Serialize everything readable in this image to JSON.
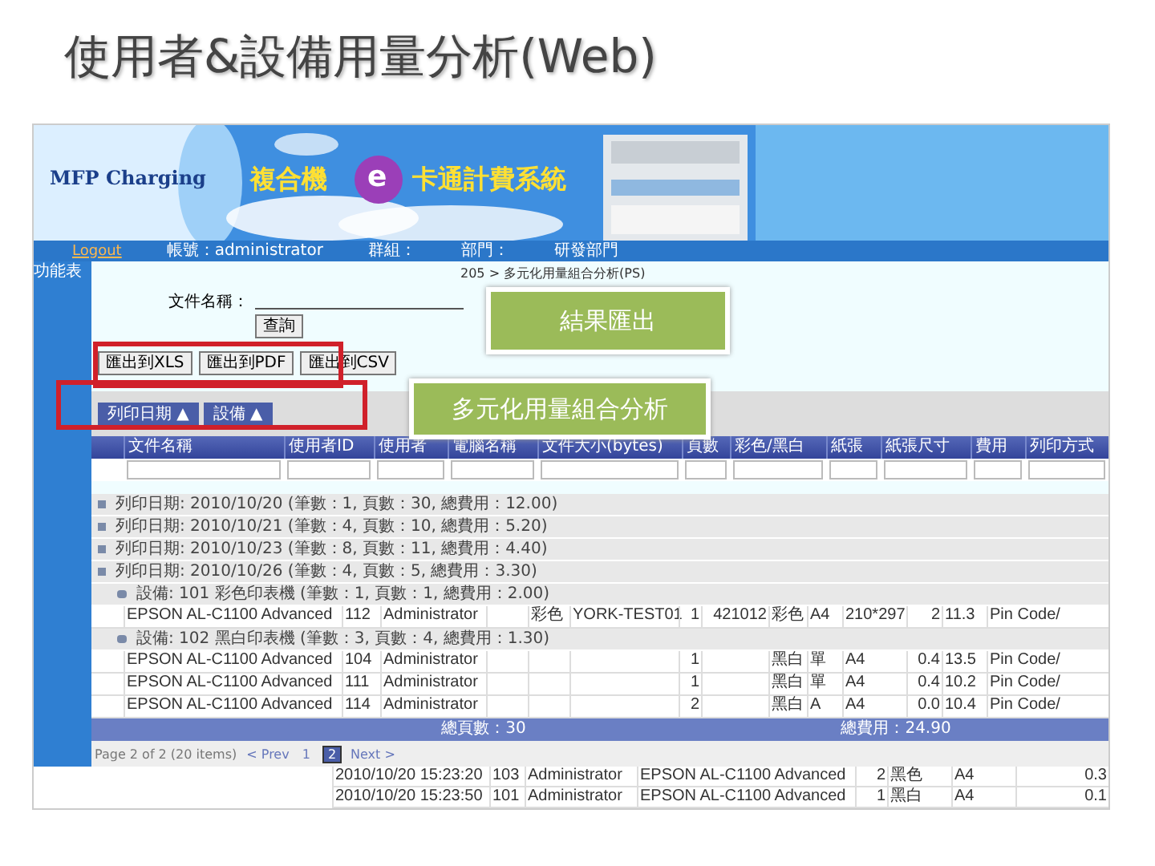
{
  "slide": {
    "title": "使用者&設備用量分析(Web)"
  },
  "banner": {
    "logo": "MFP Charging",
    "title_left": "複合機",
    "title_letter": "e",
    "title_right": "卡通計費系統"
  },
  "nav": {
    "logout": "Logout",
    "items": [
      "帳號：administrator",
      "群組：",
      "部門：",
      "研發部門"
    ]
  },
  "sidebar": {
    "items": [
      "功能表"
    ]
  },
  "breadcrumb": "205 > 多元化用量組合分析(PS)",
  "filter": {
    "label": "文件名稱：",
    "button": "查詢"
  },
  "export_buttons": [
    "匯出到XLS",
    "匯出到PDF",
    "匯出到CSV"
  ],
  "group_buttons": [
    {
      "label": "列印日期",
      "arrow": "▲"
    },
    {
      "label": "設備",
      "arrow": "▲"
    }
  ],
  "table": {
    "columns": [
      "文件名稱",
      "使用者ID",
      "使用者",
      "電腦名稱",
      "文件大小(bytes)",
      "頁數",
      "彩色/黑白",
      "紙張",
      "紙張尺寸",
      "費用",
      "列印方式"
    ],
    "groups": [
      {
        "label": "列印日期: 2010/10/20 (筆數：1, 頁數：30, 總費用：12.00)"
      },
      {
        "label": "列印日期: 2010/10/21 (筆數：4, 頁數：10, 總費用：5.20)"
      },
      {
        "label": "列印日期: 2010/10/23 (筆數：8, 頁數：11, 總費用：4.40)"
      },
      {
        "label": "列印日期: 2010/10/26 (筆數：4, 頁數：5, 總費用：3.30)",
        "children": [
          {
            "label": "設備: 101 彩色印表機 (筆數：1, 頁數：1, 總費用：2.00)",
            "rows": [
              [
                "EPSON AL-C1100 Advanced",
                "112",
                "Administrator",
                "",
                "彩色",
                "YORK-TEST01",
                "1",
                "421012",
                "彩色",
                "A4",
                "210*297",
                "2",
                "11.3",
                "Pin Code/"
              ]
            ]
          },
          {
            "label": "設備: 102 黑白印表機 (筆數：3, 頁數：4, 總費用：1.30)",
            "rows": [
              [
                "EPSON AL-C1100 Advanced",
                "104",
                "Administrator",
                "",
                "",
                "",
                "1",
                "",
                "黑白",
                "單",
                "A4",
                "0.4",
                "13.5",
                "Pin Code/"
              ],
              [
                "EPSON AL-C1100 Advanced",
                "111",
                "Administrator",
                "",
                "",
                "",
                "1",
                "",
                "黑白",
                "單",
                "A4",
                "0.4",
                "10.2",
                "Pin Code/"
              ],
              [
                "EPSON AL-C1100 Advanced",
                "114",
                "Administrator",
                "",
                "",
                "",
                "2",
                "",
                "黑白",
                "A",
                "A4",
                "0.0",
                "10.4",
                "Pin Code/"
              ]
            ]
          }
        ]
      }
    ],
    "footer": [
      "總頁數：30",
      "總費用：24.90"
    ]
  },
  "pager": {
    "summary": "Page 2 of 2 (20 items)",
    "prev": "< Prev",
    "pages": [
      {
        "label": "1",
        "selected": false
      },
      {
        "label": "2",
        "selected": true
      }
    ],
    "next": "Next >"
  },
  "extra_rows": [
    [
      "2010/10/20 15:23:20",
      "103",
      "Administrator",
      "EPSON AL-C1100 Advanced",
      "2",
      "黑色",
      "A4",
      "0.3"
    ],
    [
      "2010/10/20 15:23:50",
      "101",
      "Administrator",
      "EPSON AL-C1100 Advanced",
      "1",
      "黑白",
      "A4",
      "0.1"
    ]
  ],
  "callouts": [
    "結果匯出",
    "多元化用量組合分析"
  ]
}
